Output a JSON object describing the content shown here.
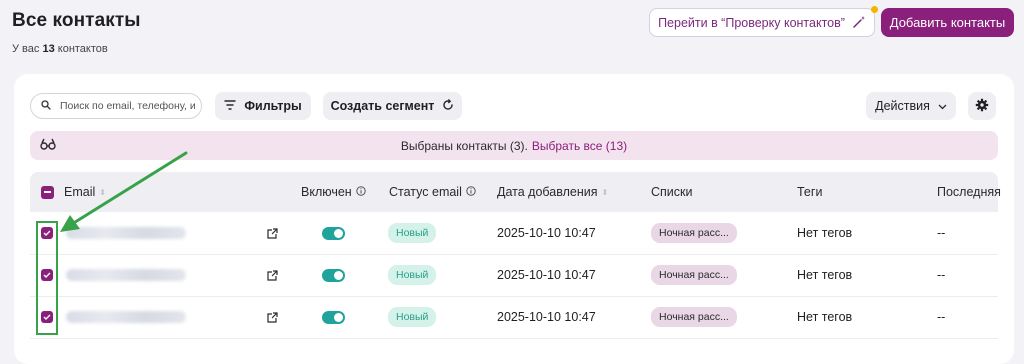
{
  "header": {
    "title": "Все контакты",
    "subtitle_prefix": "У вас",
    "subtitle_count": "13",
    "subtitle_suffix": "контактов",
    "check_button": "Перейти в “Проверку контактов”",
    "add_button": "Добавить контакты"
  },
  "toolbar": {
    "search_placeholder": "Поиск по email, телефону, и",
    "filters": "Фильтры",
    "create_segment": "Создать сегмент",
    "actions": "Действия"
  },
  "selection": {
    "text": "Выбраны контакты (3).",
    "select_all": "Выбрать все (13)"
  },
  "table": {
    "columns": [
      "Email",
      "Включен",
      "Статус email",
      "Дата добавления",
      "Списки",
      "Теги",
      "Последняя"
    ],
    "rows": [
      {
        "status": "Новый",
        "date": "2025-10-10 10:47",
        "list": "Ночная расс...",
        "tags": "Нет тегов",
        "last": "--"
      },
      {
        "status": "Новый",
        "date": "2025-10-10 10:47",
        "list": "Ночная расс...",
        "tags": "Нет тегов",
        "last": "--"
      },
      {
        "status": "Новый",
        "date": "2025-10-10 10:47",
        "list": "Ночная расс...",
        "tags": "Нет тегов",
        "last": "--"
      }
    ]
  },
  "colors": {
    "accent": "#8a1f7c",
    "toggle": "#1fa39a",
    "annotation": "#37a24a"
  }
}
